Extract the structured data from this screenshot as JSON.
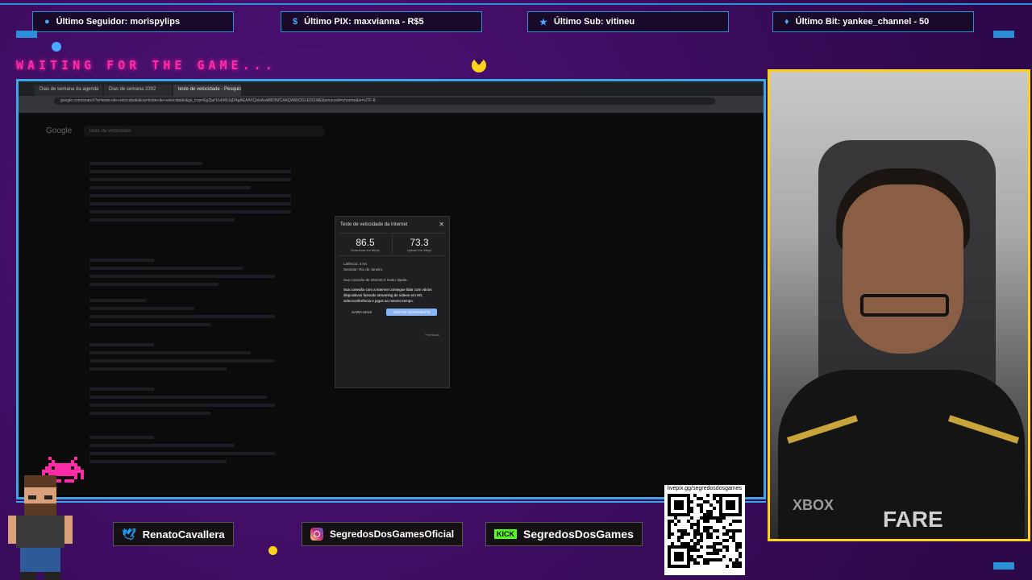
{
  "alerts": {
    "follower": "Último Seguidor: morispylips",
    "pix": "Último PIX: maxvianna - R$5",
    "sub": "Último Sub: vitineu",
    "bit": "Último Bit: yankee_channel - 50"
  },
  "overlay": {
    "waiting_text": "WAITING FOR THE GAME..."
  },
  "browser": {
    "tabs": [
      "Dias de semana da agenda",
      "Dias de semana 2302",
      "teste de velocidade - Pesquisa"
    ],
    "address": "google.com/search?q=teste+de+velocidade&oq=teste+de+velocidade&gs_lcrp=EgZjaHJvbWUqDAgAEAAYQxixAxiABDIMCAAQABhDGLEDGIAE&sourceid=chrome&ie=UTF-8",
    "search_query": "teste de velocidade",
    "google_logo": "Google"
  },
  "speedtest": {
    "title": "Teste de velocidade da Internet",
    "download": "86.5",
    "download_unit": "Download em Mbps",
    "upload": "73.3",
    "upload_unit": "Upload em Mbps",
    "latency": "Latência: 4 ms",
    "server": "Servidor: Rio de Janeiro",
    "quality": "Sua conexão de internet é muito rápida.",
    "description": "Sua conexão com a internet consegue lidar com vários dispositivos fazendo streaming de vídeos em HD, videoconferência e jogos ao mesmo tempo.",
    "more_button": "SAIBA MAIS",
    "retest_button": "TESTAR NOVAMENTE",
    "feedback": "Feedback"
  },
  "webcam": {
    "shirt_text_1": "XBOX",
    "shirt_text_2": "FARE"
  },
  "social": {
    "twitter": "RenatoCavallera",
    "instagram": "SegredosDosGamesOficial",
    "kick_logo": "KICK",
    "kick": "SegredosDosGames"
  },
  "qr": {
    "caption": "livepix.gg/segredosdosgames"
  },
  "colors": {
    "background": "#3a0c5c",
    "accent_blue": "#3aa6e8",
    "accent_yellow": "#ffd11a",
    "accent_pink": "#ff2aa8"
  }
}
